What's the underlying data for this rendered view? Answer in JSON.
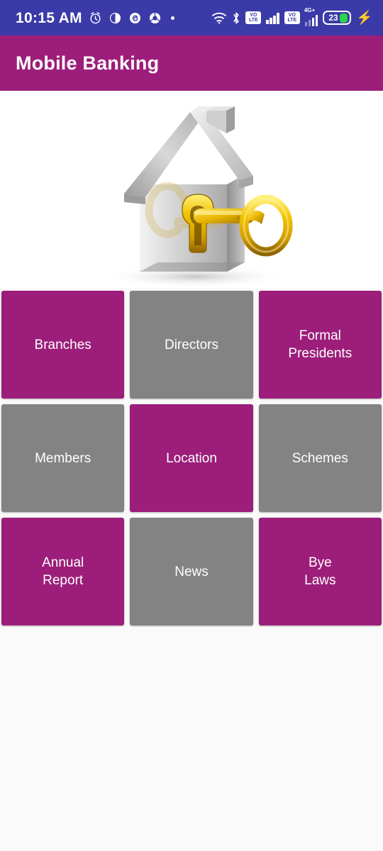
{
  "statusbar": {
    "time": "10:15 AM",
    "left_icons": [
      {
        "name": "alarm-clock-icon",
        "glyph": "⏰"
      },
      {
        "name": "clock-half-icon",
        "glyph": "◐"
      },
      {
        "name": "spiral-app-icon",
        "glyph": "@"
      },
      {
        "name": "chrome-browser-icon",
        "glyph": "◉"
      },
      {
        "name": "notification-dot-icon",
        "glyph": "•"
      }
    ],
    "wifi_label": "wifi-icon",
    "bluetooth_glyph": "✳",
    "volte_line1": "VO",
    "volte_line2": "LTE",
    "network_label": "4G+",
    "battery_level": "23",
    "charging_glyph": "⚡"
  },
  "appbar": {
    "title": "Mobile Banking"
  },
  "hero": {
    "name": "house-with-key-image",
    "alt": "Silver 3D house with golden key in keyhole"
  },
  "grid": {
    "tiles": [
      {
        "label": "Branches",
        "color": "magenta"
      },
      {
        "label": "Directors",
        "color": "gray"
      },
      {
        "label": "Formal\nPresidents",
        "color": "magenta"
      },
      {
        "label": "Members",
        "color": "gray"
      },
      {
        "label": "Location",
        "color": "magenta"
      },
      {
        "label": "Schemes",
        "color": "gray"
      },
      {
        "label": "Annual\nReport",
        "color": "magenta"
      },
      {
        "label": "News",
        "color": "gray"
      },
      {
        "label": "Bye\nLaws",
        "color": "magenta"
      }
    ]
  },
  "colors": {
    "statusbar_bg": "#3A3AA8",
    "brand_magenta": "#9C1E7A",
    "tile_gray": "#838383",
    "page_bg": "#FAFAFA",
    "battery_green": "#2BD44A"
  }
}
